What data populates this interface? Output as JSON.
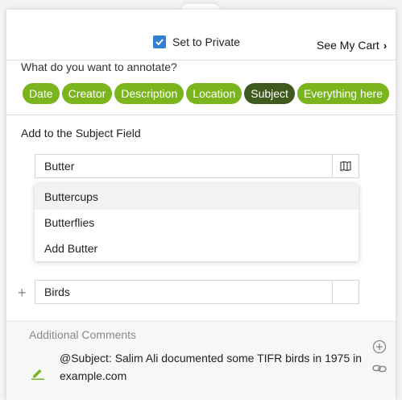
{
  "header": {
    "private_label": "Set to Private",
    "private_checked": true,
    "cart_label": "See My Cart",
    "accent_color": "#2f7fd6"
  },
  "annotate": {
    "question": "What do you want to annotate?",
    "chips": [
      {
        "label": "Date",
        "active": false
      },
      {
        "label": "Creator",
        "active": false
      },
      {
        "label": "Description",
        "active": false
      },
      {
        "label": "Location",
        "active": false
      },
      {
        "label": "Subject",
        "active": true
      },
      {
        "label": "Everything here",
        "active": false
      }
    ],
    "chip_color": "#7ab51d",
    "chip_active_color": "#3f5a1e"
  },
  "subject": {
    "heading": "Add to the Subject Field",
    "input_value": "Butter",
    "suggestions": [
      "Buttercups",
      "Butterflies",
      "Add Butter"
    ],
    "second_value": "Birds"
  },
  "comments": {
    "label": "Additional Comments",
    "text": "@Subject: Salim Ali documented some TIFR birds in 1975 in example.com"
  }
}
